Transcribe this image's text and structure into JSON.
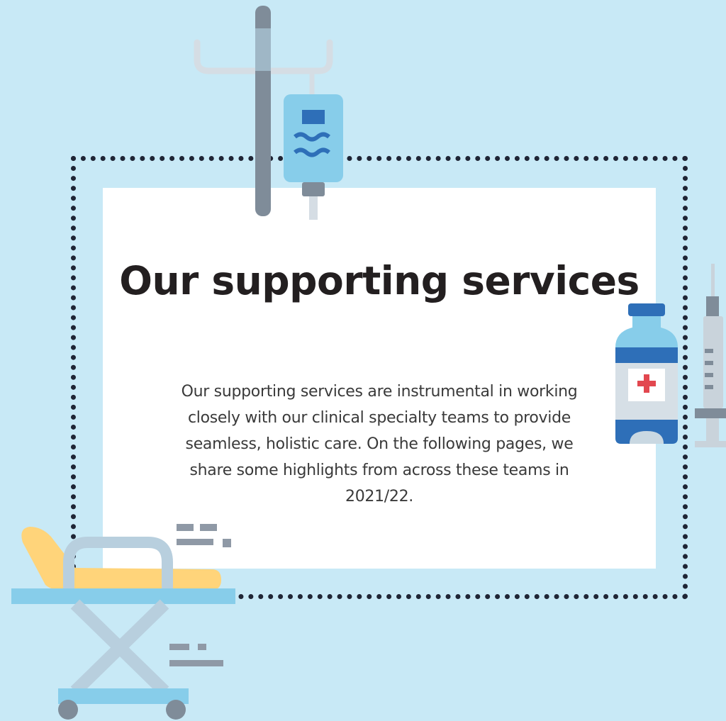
{
  "heading": "Our supporting services",
  "body": "Our supporting services are instrumental in working closely with our clinical specialty teams to provide seamless, holistic care. On the following pages, we share some highlights from across these teams in 2021/22.",
  "illustrations": [
    "iv-drip-stand-icon",
    "medicine-bottle-icon",
    "syringe-icon",
    "hospital-stretcher-icon"
  ],
  "colors": {
    "background": "#c8e9f6",
    "card": "#ffffff",
    "text": "#231f20",
    "accent_blue": "#2e6fb8",
    "light_blue": "#87cdea",
    "yellow": "#ffd47a",
    "cross_red": "#e2474f"
  }
}
